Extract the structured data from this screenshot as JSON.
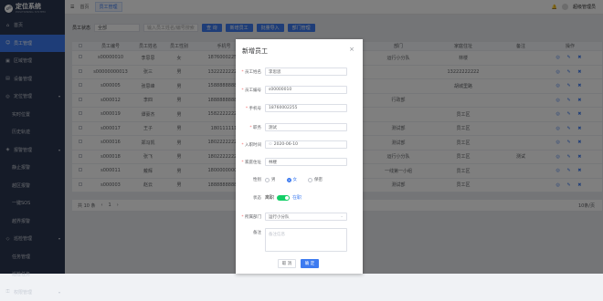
{
  "app": {
    "title": "定位系统",
    "subtitle": "POSITIONING SYSTEM",
    "logo_glyph": "☍"
  },
  "sidebar": {
    "items": [
      {
        "label": "首页",
        "icon": "home-icon",
        "glyph": "⌂",
        "active": false,
        "sub": false
      },
      {
        "label": "员工管理",
        "icon": "user-icon",
        "glyph": "☺",
        "active": true,
        "sub": false
      },
      {
        "label": "区域管理",
        "icon": "area-icon",
        "glyph": "▣",
        "active": false,
        "sub": false
      },
      {
        "label": "设备管理",
        "icon": "device-icon",
        "glyph": "▤",
        "active": false,
        "sub": false
      },
      {
        "label": "定位管理",
        "icon": "location-icon",
        "glyph": "◎",
        "active": false,
        "sub": false,
        "caret": "▾"
      },
      {
        "label": "实时位置",
        "active": false,
        "sub": true
      },
      {
        "label": "历史轨迹",
        "active": false,
        "sub": true
      },
      {
        "label": "报警管理",
        "icon": "alarm-icon",
        "glyph": "◈",
        "active": false,
        "sub": false,
        "caret": "▾"
      },
      {
        "label": "静止报警",
        "active": false,
        "sub": true
      },
      {
        "label": "越区报警",
        "active": false,
        "sub": true
      },
      {
        "label": "一键SOS",
        "active": false,
        "sub": true
      },
      {
        "label": "越界报警",
        "active": false,
        "sub": true
      },
      {
        "label": "巡检管理",
        "icon": "patrol-icon",
        "glyph": "◇",
        "active": false,
        "sub": false,
        "caret": "▾"
      },
      {
        "label": "任务管理",
        "active": false,
        "sub": true
      },
      {
        "label": "巡检任务",
        "active": false,
        "sub": true
      },
      {
        "label": "权限管理",
        "icon": "lock-icon",
        "glyph": "⚿",
        "active": false,
        "sub": false,
        "caret": "▾"
      }
    ]
  },
  "topbar": {
    "breadcrumb_home": "首页",
    "breadcrumb_current": "员工管理",
    "menu_glyph": "☰",
    "bell_glyph": "🔔",
    "user_name": "超级管理员"
  },
  "search": {
    "label": "员工状态",
    "select_value": "全部",
    "placeholder": "输入员工姓名/编号搜索",
    "btn_search": "查 询",
    "btn_add": "新增员工",
    "btn_import": "批量导入",
    "btn_dept": "部门管理"
  },
  "table": {
    "headers": [
      "",
      "员工编号",
      "员工姓名",
      "员工性别",
      "手机号",
      "职务",
      "入职时间",
      "部门",
      "家庭住址",
      "备注",
      "操作"
    ],
    "rows": [
      [
        "",
        "s00000010",
        "李思思",
        "女",
        "18760002255",
        "测试",
        "2020-06-10",
        "运行小分队",
        "林楼",
        "",
        "◎ ✎ ✖"
      ],
      [
        "",
        "s00000000013",
        "张三",
        "男",
        "13222222222",
        "",
        "",
        "",
        "13222222222",
        "",
        "◎ ✎ ✖"
      ],
      [
        "",
        "s000005",
        "张思峰",
        "男",
        "15888888888",
        "",
        "",
        "",
        "胡城里路",
        "",
        "◎ ✎ ✖"
      ],
      [
        "",
        "s000012",
        "李四",
        "男",
        "18888888888",
        "",
        "",
        "行政部",
        "",
        "",
        "◎ ✎ ✖"
      ],
      [
        "",
        "s000019",
        "谭豪杰",
        "男",
        "15822222222",
        "",
        "",
        "",
        "员工区",
        "",
        "◎ ✎ ✖"
      ],
      [
        "",
        "s000017",
        "王子",
        "男",
        "180111111",
        "",
        "",
        "测试部",
        "员工区",
        "",
        "◎ ✎ ✖"
      ],
      [
        "",
        "s000016",
        "郑冯凯",
        "男",
        "18022222222",
        "",
        "",
        "测试部",
        "员工区",
        "",
        "◎ ✎ ✖"
      ],
      [
        "",
        "s000018",
        "张飞",
        "男",
        "18022222222",
        "",
        "",
        "运行小分队",
        "员工区",
        "测试",
        "◎ ✎ ✖"
      ],
      [
        "",
        "s000011",
        "戴辉",
        "男",
        "18000000000",
        "",
        "",
        "一线第一小组",
        "员工区",
        "",
        "◎ ✎ ✖"
      ],
      [
        "",
        "s000003",
        "赵云",
        "男",
        "18888888888",
        "",
        "",
        "测试部",
        "员工区",
        "",
        "◎ ✎ ✖"
      ]
    ]
  },
  "pager": {
    "total": "共 10 条",
    "prev": "‹",
    "page": "1",
    "next": "›",
    "size": "10条/页"
  },
  "dialog": {
    "title": "新增员工",
    "close": "×",
    "fields": {
      "name_label": "员工姓名",
      "name_value": "李思思",
      "code_label": "员工编号",
      "code_value": "s00000010",
      "phone_label": "手机号",
      "phone_value": "18760002255",
      "job_label": "职务",
      "job_value": "测试",
      "date_label": "入职时间",
      "date_value": "2020-06-10",
      "date_icon": "⊙",
      "address_label": "家庭住址",
      "address_value": "林楼",
      "gender_label": "性别",
      "gender_options": [
        "男",
        "女",
        "保密"
      ],
      "gender_selected": "女",
      "status_label": "状态",
      "status_off": "离职",
      "status_on": "在职",
      "dept_label": "所属部门",
      "dept_value": "运行小分队",
      "dept_arrow": "⌄",
      "remark_label": "备注",
      "remark_placeholder": "备注信息"
    },
    "btn_cancel": "取 消",
    "btn_ok": "确 定",
    "required_mark": "*"
  }
}
